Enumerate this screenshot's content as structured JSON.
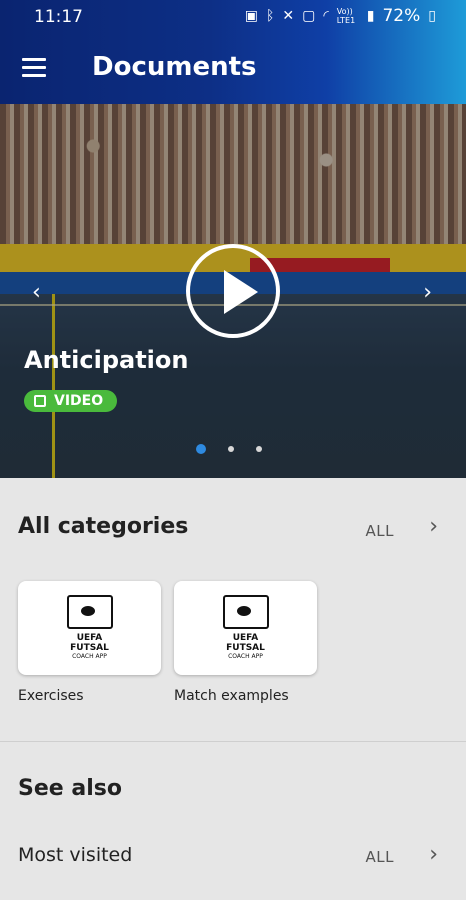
{
  "status_bar": {
    "time": "11:17",
    "battery": "72%",
    "network": "Vo)) LTE1"
  },
  "app_bar": {
    "title": "Documents"
  },
  "hero": {
    "title": "Anticipation",
    "badge_label": "VIDEO",
    "slides_total": 3,
    "active_slide": 1
  },
  "categories": {
    "title": "All categories",
    "all_label": "ALL",
    "items": [
      {
        "label": "Exercises",
        "logo_line1": "UEFA",
        "logo_line2": "FUTSAL",
        "logo_line3": "COACH APP"
      },
      {
        "label": "Match examples",
        "logo_line1": "UEFA",
        "logo_line2": "FUTSAL",
        "logo_line3": "COACH APP"
      }
    ]
  },
  "see_also": {
    "title": "See also",
    "rows": [
      {
        "label": "Most visited",
        "all_label": "ALL"
      }
    ]
  },
  "colors": {
    "accent_green": "#4aba3c",
    "active_dot": "#2e8ae0",
    "appbar_dark": "#0a2470",
    "appbar_light": "#1e9bd8"
  },
  "icons": [
    "menu-icon",
    "play-icon",
    "chevron-left-icon",
    "chevron-right-icon",
    "video-icon"
  ]
}
